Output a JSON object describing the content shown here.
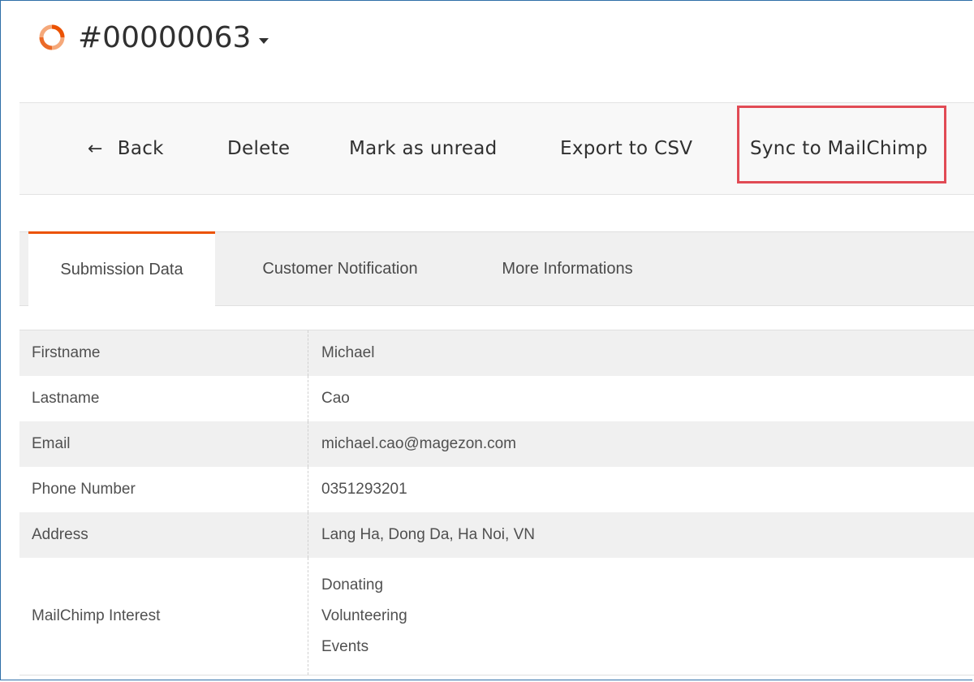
{
  "header": {
    "record_title": "#00000063"
  },
  "toolbar": {
    "back_label": "Back",
    "delete_label": "Delete",
    "mark_unread_label": "Mark as unread",
    "export_csv_label": "Export to CSV",
    "sync_mailchimp_label": "Sync to MailChimp"
  },
  "tabs": [
    {
      "label": "Submission Data",
      "active": true
    },
    {
      "label": "Customer Notification",
      "active": false
    },
    {
      "label": "More Informations",
      "active": false
    }
  ],
  "submission": {
    "rows": [
      {
        "label": "Firstname",
        "value": "Michael"
      },
      {
        "label": "Lastname",
        "value": "Cao"
      },
      {
        "label": "Email",
        "value": "michael.cao@magezon.com"
      },
      {
        "label": "Phone Number",
        "value": "0351293201"
      },
      {
        "label": "Address",
        "value": "Lang Ha, Dong Da, Ha Noi, VN"
      }
    ],
    "interest": {
      "label": "MailChimp Interest",
      "values": [
        "Donating",
        "Volunteering",
        "Events"
      ]
    }
  },
  "colors": {
    "accent": "#eb5202",
    "highlight": "#e14b55",
    "frame": "#2f6fa8"
  }
}
